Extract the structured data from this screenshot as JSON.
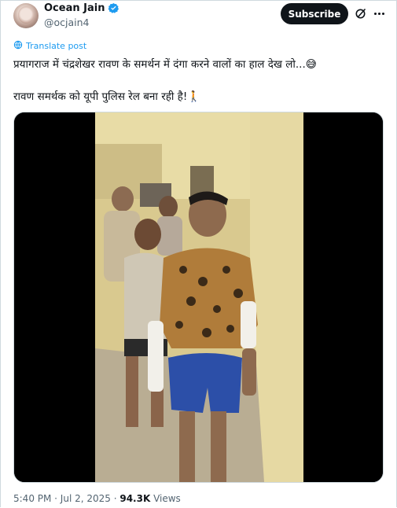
{
  "tweet": {
    "author_name": "Ocean Jain",
    "author_handle": "@ocjain4",
    "subscribe_label": "Subscribe",
    "translate_label": "Translate post",
    "line1": "प्रयागराज में चंद्रशेखर रावण के समर्थन में दंगा करने वालों का हाल देख लो...",
    "line1_emoji": "😅",
    "line2": "रावण समर्थक को यूपी पुलिस रेल बना रही है!",
    "line2_emoji": "🚶",
    "timestamp": "5:40 PM · Jul 2, 2025",
    "separator": " · ",
    "views_count": "94.3K",
    "views_label": " Views"
  },
  "colors": {
    "accent": "#1d9bf0",
    "subscribe_bg": "#0f1419",
    "text_secondary": "#536471"
  },
  "icons": [
    "verified-badge-icon",
    "grok-icon",
    "more-icon",
    "translate-icon"
  ]
}
